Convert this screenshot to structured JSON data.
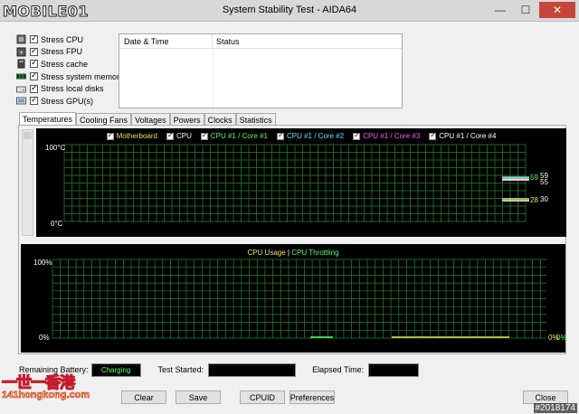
{
  "window": {
    "title": "System Stability Test - AIDA64",
    "watermark_logo": "MOBILE01",
    "minimize": "—",
    "maximize": "☐",
    "close": "✕"
  },
  "stress": {
    "items": [
      {
        "label": "Stress CPU",
        "icon": "cpu-icon",
        "checked": true
      },
      {
        "label": "Stress FPU",
        "icon": "fpu-icon",
        "checked": true
      },
      {
        "label": "Stress cache",
        "icon": "cache-icon",
        "checked": true
      },
      {
        "label": "Stress system memory",
        "icon": "memory-icon",
        "checked": true
      },
      {
        "label": "Stress local disks",
        "icon": "disk-icon",
        "checked": true
      },
      {
        "label": "Stress GPU(s)",
        "icon": "gpu-icon",
        "checked": true
      }
    ]
  },
  "log": {
    "columns": [
      "Date & Time",
      "Status"
    ]
  },
  "tabs": [
    "Temperatures",
    "Cooling Fans",
    "Voltages",
    "Powers",
    "Clocks",
    "Statistics"
  ],
  "temp_chart": {
    "legend": [
      {
        "label": "Motherboard",
        "color": "#e8e05a"
      },
      {
        "label": "CPU",
        "color": "#ffffff"
      },
      {
        "label": "CPU #1 / Core #1",
        "color": "#5cff5c"
      },
      {
        "label": "CPU #1 / Core #2",
        "color": "#64e0ff"
      },
      {
        "label": "CPU #1 / Core #3",
        "color": "#ff58ff"
      },
      {
        "label": "CPU #1 / Core #4",
        "color": "#ffffff"
      }
    ],
    "y_top": "100°C",
    "y_bottom": "0°C",
    "val_high": "59",
    "val_high2": "59",
    "val_high3": "55",
    "val_low1": "28",
    "val_low2": "30"
  },
  "usage_chart": {
    "legend_a": "CPU Usage",
    "legend_sep": "|",
    "legend_b": "CPU Throttling",
    "y_top": "100%",
    "y_bottom": "0%",
    "val_right1": "0%",
    "val_right2": "0%"
  },
  "status": {
    "battery_label": "Remaining Battery:",
    "battery_value": "Charging",
    "started_label": "Test Started:",
    "started_value": "",
    "elapsed_label": "Elapsed Time:",
    "elapsed_value": ""
  },
  "buttons": {
    "clear": "Clear",
    "save": "Save",
    "cpuid": "CPUID",
    "preferences": "Preferences",
    "close": "Close"
  },
  "watermark": {
    "line1": "一世一香港",
    "line2": "141hongkong.com",
    "id": "#2018174"
  }
}
